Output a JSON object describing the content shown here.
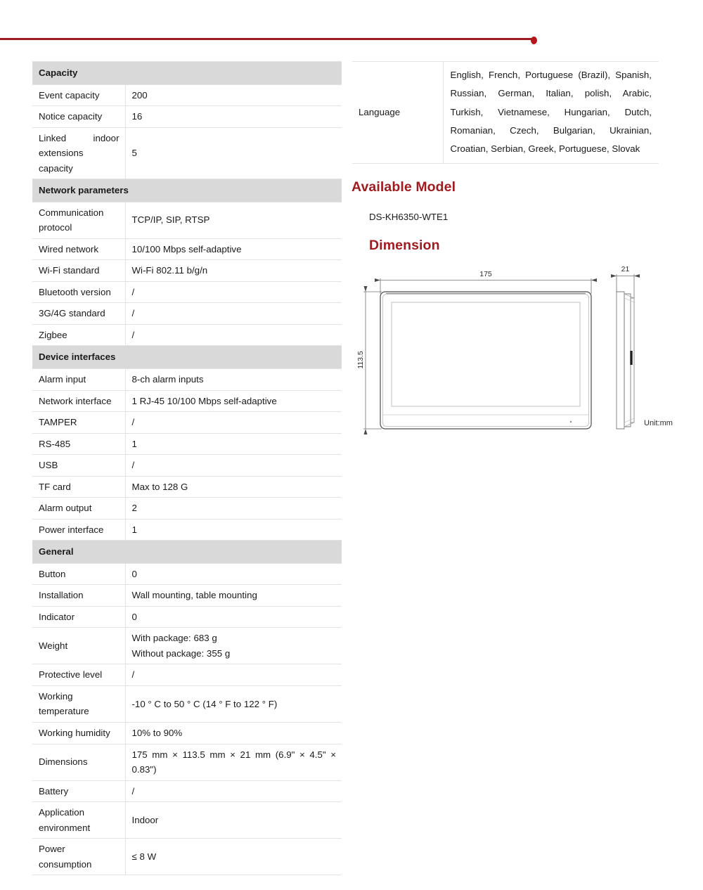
{
  "header": {
    "rule_color": "#9e1b1f",
    "dot_icon": "red-dot-icon"
  },
  "left_table": {
    "rows": [
      {
        "type": "section",
        "label": "Capacity"
      },
      {
        "type": "row",
        "key": "Event capacity",
        "value": "200"
      },
      {
        "type": "row",
        "key": "Notice capacity",
        "value": "16"
      },
      {
        "type": "row",
        "key": "Linked indoor extensions capacity",
        "value": "5"
      },
      {
        "type": "section",
        "label": "Network parameters"
      },
      {
        "type": "row",
        "key": "Communication protocol",
        "value": "TCP/IP, SIP, RTSP"
      },
      {
        "type": "row",
        "key": "Wired network",
        "value": "10/100 Mbps self-adaptive"
      },
      {
        "type": "row",
        "key": "Wi-Fi standard",
        "value": "Wi-Fi 802.11 b/g/n"
      },
      {
        "type": "row",
        "key": "Bluetooth version",
        "value": "/"
      },
      {
        "type": "row",
        "key": "3G/4G standard",
        "value": "/"
      },
      {
        "type": "row",
        "key": "Zigbee",
        "value": "/"
      },
      {
        "type": "section",
        "label": "Device interfaces"
      },
      {
        "type": "row",
        "key": "Alarm input",
        "value": "8-ch alarm inputs"
      },
      {
        "type": "row",
        "key": "Network interface",
        "value": "1 RJ-45 10/100 Mbps self-adaptive"
      },
      {
        "type": "row",
        "key": "TAMPER",
        "value": "/"
      },
      {
        "type": "row",
        "key": "RS-485",
        "value": "1"
      },
      {
        "type": "row",
        "key": "USB",
        "value": "/"
      },
      {
        "type": "row",
        "key": "TF card",
        "value": "Max to 128 G"
      },
      {
        "type": "row",
        "key": "Alarm output",
        "value": "2"
      },
      {
        "type": "row",
        "key": "Power interface",
        "value": "1"
      },
      {
        "type": "section",
        "label": "General"
      },
      {
        "type": "row",
        "key": "Button",
        "value": "0"
      },
      {
        "type": "row",
        "key": "Installation",
        "value": "Wall mounting, table mounting"
      },
      {
        "type": "row",
        "key": "Indicator",
        "value": "0"
      },
      {
        "type": "row",
        "key": "Weight",
        "value": "With package: 683 g\nWithout package: 355 g"
      },
      {
        "type": "row",
        "key": "Protective level",
        "value": "/"
      },
      {
        "type": "row",
        "key": "Working temperature",
        "value": "-10 ° C to 50 ° C (14 ° F to 122 ° F)"
      },
      {
        "type": "row",
        "key": "Working humidity",
        "value": "10% to 90%"
      },
      {
        "type": "row",
        "key": "Dimensions",
        "value": "175 mm × 113.5 mm × 21 mm (6.9\" × 4.5\" × 0.83\")"
      },
      {
        "type": "row",
        "key": "Battery",
        "value": "/"
      },
      {
        "type": "row",
        "key": "Application environment",
        "value": "Indoor"
      },
      {
        "type": "row",
        "key": "Power consumption",
        "value": "≤ 8 W"
      }
    ]
  },
  "right_table": {
    "language_key": "Language",
    "language_value": "English, French, Portuguese (Brazil), Spanish, Russian, German, Italian, polish, Arabic, Turkish, Vietnamese, Hungarian, Dutch, Romanian, Czech, Bulgarian, Ukrainian, Croatian, Serbian, Greek, Portuguese, Slovak"
  },
  "available_model": {
    "heading": "Available Model",
    "model": "DS-KH6350-WTE1"
  },
  "dimension": {
    "heading": "Dimension",
    "width_label": "175",
    "height_label": "113.5",
    "depth_label": "21",
    "unit_label": "Unit:mm"
  },
  "colors": {
    "brand_red": "#9e1b1f",
    "section_grey": "#d9d9d9",
    "rule_grey": "#e3e3e3",
    "text": "#1a1a1a"
  }
}
